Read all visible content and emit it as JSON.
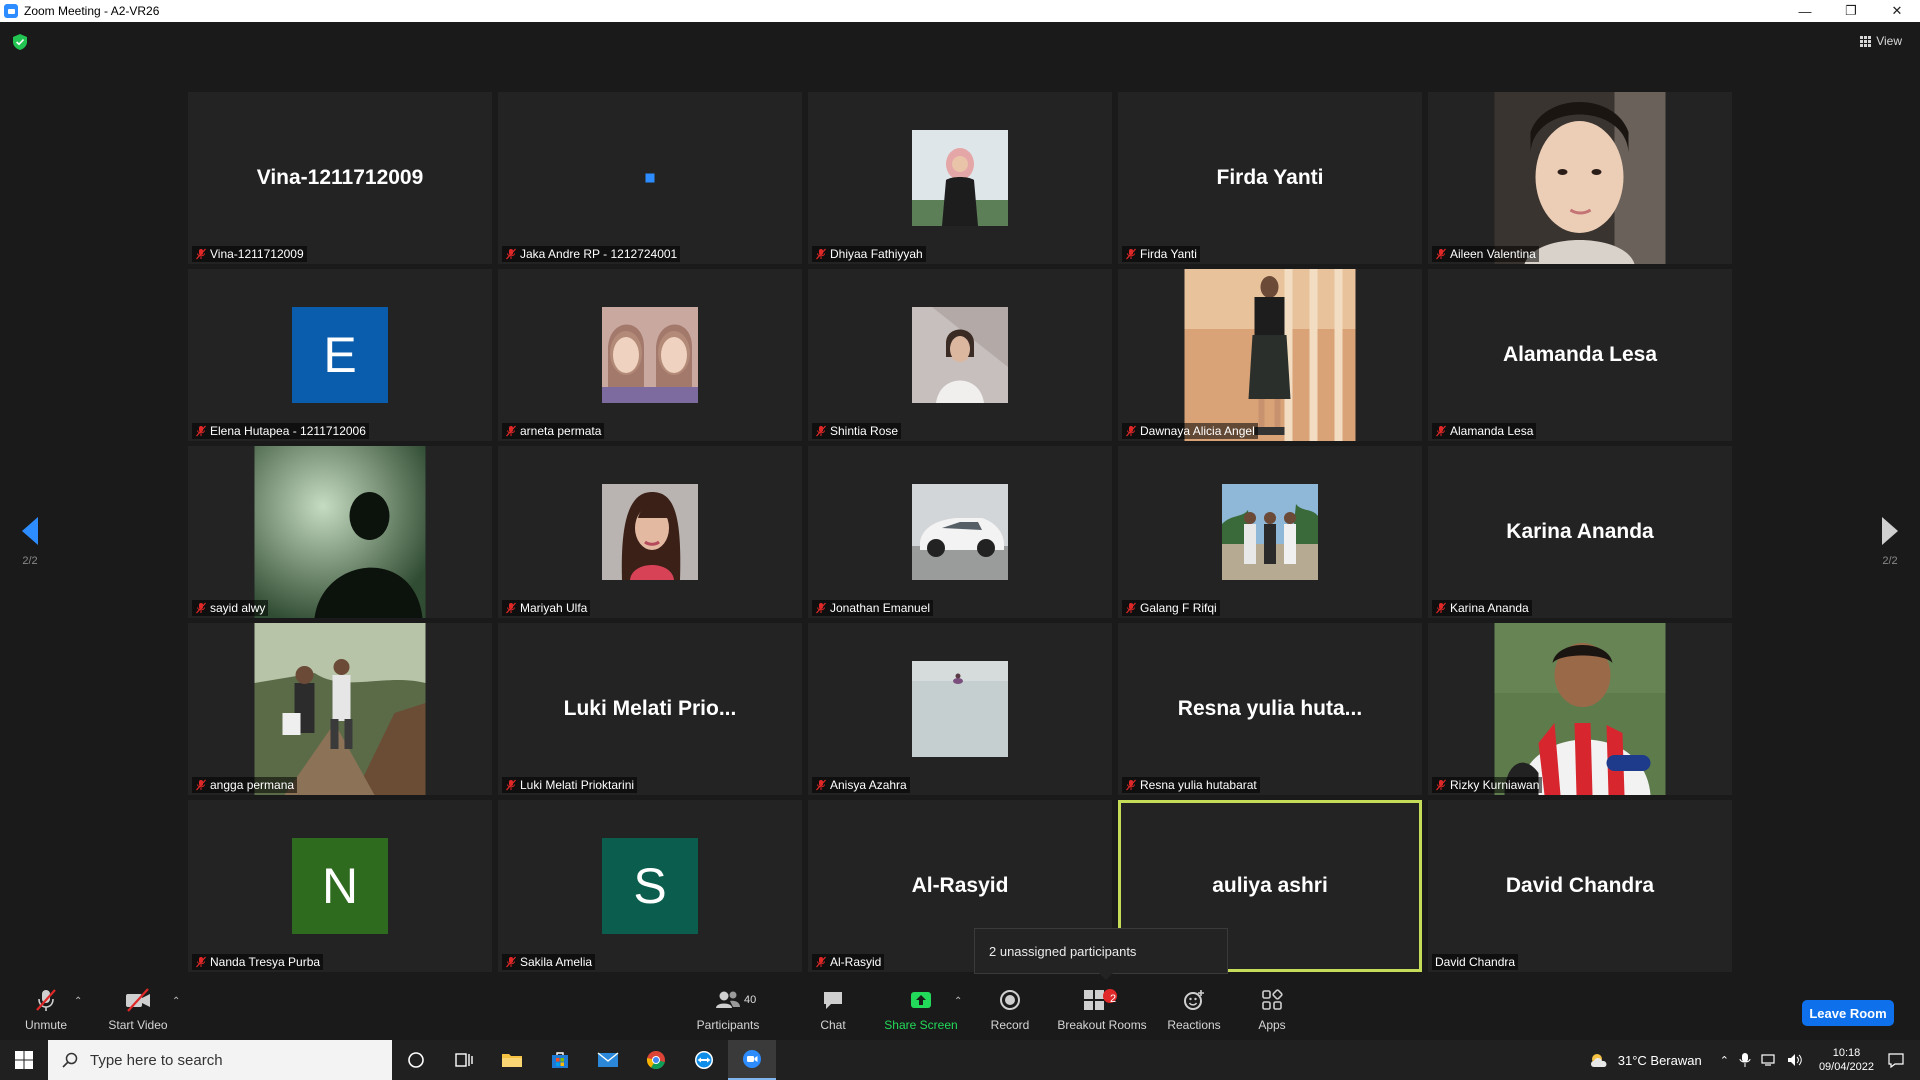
{
  "window": {
    "title": "Zoom Meeting - A2-VR26"
  },
  "view_label": "View",
  "pagination": {
    "left": "2/2",
    "right": "2/2"
  },
  "participants": [
    {
      "name": "Vina-1211712009",
      "display": "Vina-1211712009",
      "kind": "name"
    },
    {
      "name": "Jaka Andre RP - 1212724001",
      "display": "",
      "kind": "dot"
    },
    {
      "name": "Dhiyaa Fathiyyah",
      "display": "",
      "kind": "photo",
      "photo": "hijab-portrait"
    },
    {
      "name": "Firda Yanti",
      "display": "Firda Yanti",
      "kind": "name"
    },
    {
      "name": "Aileen Valentina",
      "display": "",
      "kind": "photo-big",
      "photo": "selfie-portrait"
    },
    {
      "name": "Elena Hutapea - 1211712006",
      "display": "E",
      "kind": "avatar",
      "color": "#0a5cad"
    },
    {
      "name": "arneta permata",
      "display": "",
      "kind": "photo",
      "photo": "double-portrait"
    },
    {
      "name": "Shintia Rose",
      "display": "",
      "kind": "photo",
      "photo": "light-portrait"
    },
    {
      "name": "Dawnaya Alicia Angel",
      "display": "",
      "kind": "photo-big",
      "photo": "hallway-standing"
    },
    {
      "name": "Alamanda Lesa",
      "display": "Alamanda Lesa",
      "kind": "name"
    },
    {
      "name": "sayid alwy",
      "display": "",
      "kind": "photo-big",
      "photo": "shadow-silhouette"
    },
    {
      "name": "Mariyah Ulfa",
      "display": "",
      "kind": "photo",
      "photo": "woman-portrait"
    },
    {
      "name": "Jonathan Emanuel",
      "display": "",
      "kind": "photo",
      "photo": "white-car"
    },
    {
      "name": "Galang F Rifqi",
      "display": "",
      "kind": "photo",
      "photo": "group-photo"
    },
    {
      "name": "Karina Ananda",
      "display": "Karina Ananda",
      "kind": "name"
    },
    {
      "name": "angga permana",
      "display": "",
      "kind": "photo-big",
      "photo": "forest-hikers"
    },
    {
      "name": "Luki Melati Prioktarini",
      "display": "Luki Melati Prio...",
      "kind": "name"
    },
    {
      "name": "Anisya Azahra",
      "display": "",
      "kind": "photo",
      "photo": "sea-figure"
    },
    {
      "name": "Resna yulia hutabarat",
      "display": "Resna yulia huta...",
      "kind": "name"
    },
    {
      "name": "Rizky Kurniawan",
      "display": "",
      "kind": "photo-big",
      "photo": "football-jersey"
    },
    {
      "name": "Nanda Tresya Purba",
      "display": "N",
      "kind": "avatar",
      "color": "#2f6b1f"
    },
    {
      "name": "Sakila Amelia",
      "display": "S",
      "kind": "avatar",
      "color": "#0b5d4e"
    },
    {
      "name": "Al-Rasyid",
      "display": "Al-Rasyid",
      "kind": "name"
    },
    {
      "name": "auliya ashri",
      "display": "auliya ashri",
      "kind": "name",
      "active": true,
      "label": ""
    },
    {
      "name": "David Chandra",
      "display": "David Chandra",
      "kind": "name",
      "unmuted": true
    }
  ],
  "tooltip": "2 unassigned participants",
  "controls": {
    "unmute": "Unmute",
    "start_video": "Start Video",
    "participants": "Participants",
    "participants_count": "40",
    "chat": "Chat",
    "share_screen": "Share Screen",
    "record": "Record",
    "breakout_rooms": "Breakout Rooms",
    "breakout_badge": "2",
    "reactions": "Reactions",
    "apps": "Apps",
    "leave_room": "Leave Room"
  },
  "taskbar": {
    "search_placeholder": "Type here to search",
    "weather": "31°C  Berawan",
    "time": "10:18",
    "date": "09/04/2022"
  },
  "colors": {
    "accent": "#2d8cff",
    "active_speaker": "#c4dc58",
    "share_green": "#23d959",
    "leave_blue": "#0e71eb",
    "muted_red": "#e02828"
  }
}
